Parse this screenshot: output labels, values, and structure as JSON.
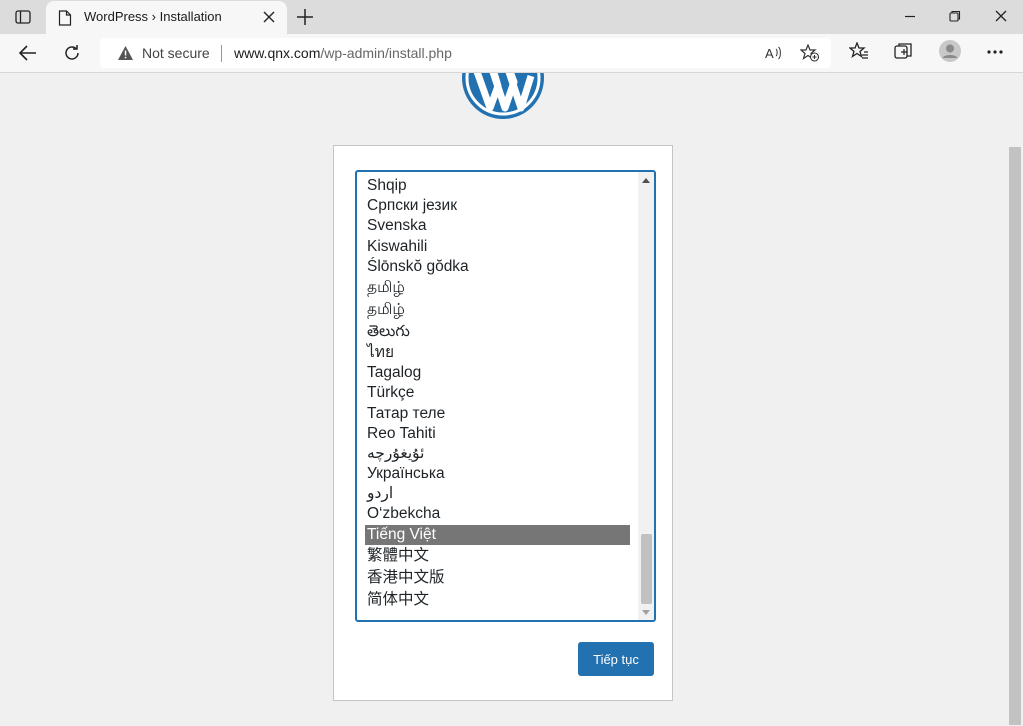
{
  "browser": {
    "tab": {
      "title": "WordPress › Installation"
    },
    "address": {
      "security": "Not secure",
      "url_host": "www.qnx.com",
      "url_path": "/wp-admin/install.php"
    },
    "icons": [
      "tab-actions-icon",
      "page-icon",
      "close-icon",
      "plus-icon",
      "minimize-icon",
      "restore-icon",
      "window-close-icon",
      "back-icon",
      "refresh-icon",
      "warning-icon",
      "read-aloud-icon",
      "add-favorite-icon",
      "favorites-icon",
      "collections-icon",
      "profile-icon",
      "more-icon"
    ]
  },
  "installer": {
    "languages": [
      "Shqip",
      "Српски језик",
      "Svenska",
      "Kiswahili",
      "Ślōnskŏ gŏdka",
      "தமிழ்",
      "தமிழ்",
      "తెలుగు",
      "ไทย",
      "Tagalog",
      "Türkçe",
      "Татар теле",
      "Reo Tahiti",
      "ئۇيغۇرچە",
      "Українська",
      "اردو",
      "O‘zbekcha",
      "Tiếng Việt",
      "繁體中文",
      "香港中文版",
      "简体中文"
    ],
    "selected_language": "Tiếng Việt",
    "continue_label": "Tiếp tục"
  },
  "colors": {
    "wp_blue": "#2271b1",
    "selected_option": "#767676",
    "page_bg": "#f0f0f1"
  }
}
